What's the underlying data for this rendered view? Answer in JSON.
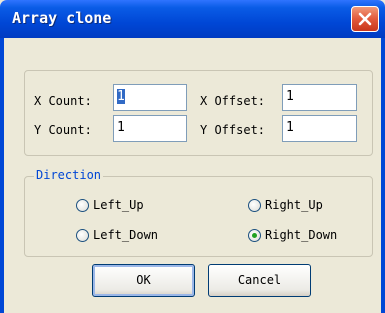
{
  "window": {
    "title": "Array clone"
  },
  "fields": {
    "x_count": {
      "label": "X Count:",
      "value": "1"
    },
    "y_count": {
      "label": "Y Count:",
      "value": "1"
    },
    "x_offset": {
      "label": "X Offset:",
      "value": "1"
    },
    "y_offset": {
      "label": "Y Offset:",
      "value": "1"
    }
  },
  "direction": {
    "legend": "Direction",
    "options": [
      "Left_Up",
      "Right_Up",
      "Left_Down",
      "Right_Down"
    ],
    "selected": "Right_Down"
  },
  "buttons": {
    "ok": "OK",
    "cancel": "Cancel"
  },
  "colors": {
    "titlebar": "#0a5ce6",
    "close": "#e2593b",
    "legend": "#0046d5",
    "selection": "#316ac5",
    "radio_dot": "#21a121"
  },
  "icons": {
    "close": "close-icon"
  }
}
